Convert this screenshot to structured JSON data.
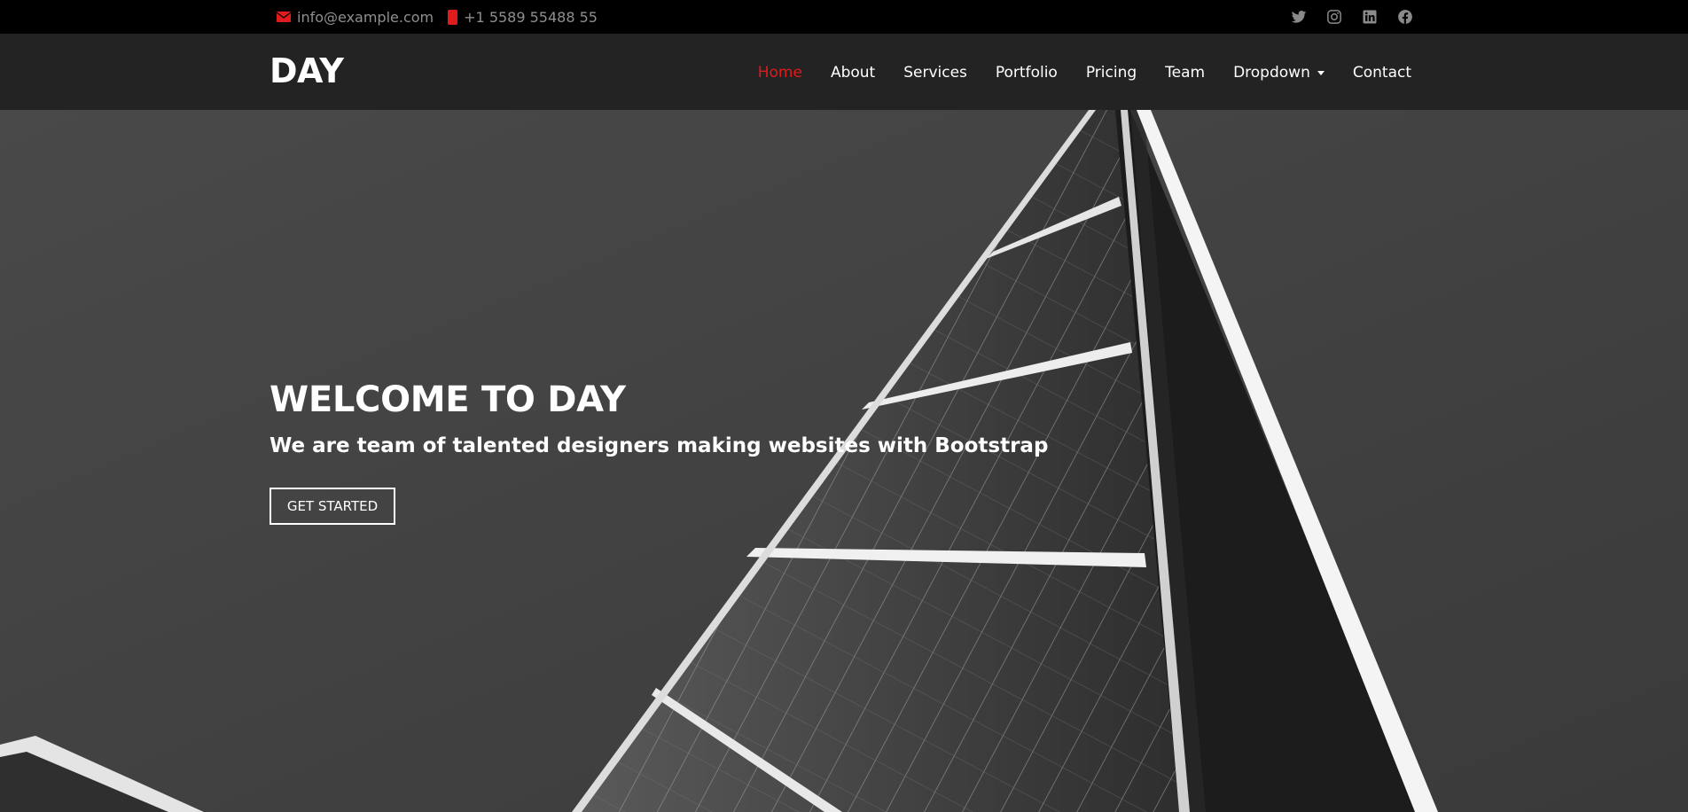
{
  "topbar": {
    "email": "info@example.com",
    "phone": "+1 5589 55488 55",
    "social": [
      "twitter-icon",
      "instagram-icon",
      "linkedin-icon",
      "facebook-icon"
    ]
  },
  "header": {
    "logo": "DAY",
    "nav": [
      {
        "label": "Home",
        "active": true
      },
      {
        "label": "About"
      },
      {
        "label": "Services"
      },
      {
        "label": "Portfolio"
      },
      {
        "label": "Pricing"
      },
      {
        "label": "Team"
      },
      {
        "label": "Dropdown"
      },
      {
        "label": "Contact"
      }
    ]
  },
  "hero": {
    "title": "WELCOME TO DAY",
    "subtitle": "We are team of talented designers making websites with Bootstrap",
    "button": "GET STARTED"
  },
  "colors": {
    "accent": "#e01b1b",
    "topbar_bg": "#000000",
    "header_bg": "#232323",
    "hero_bg": "#434343"
  }
}
